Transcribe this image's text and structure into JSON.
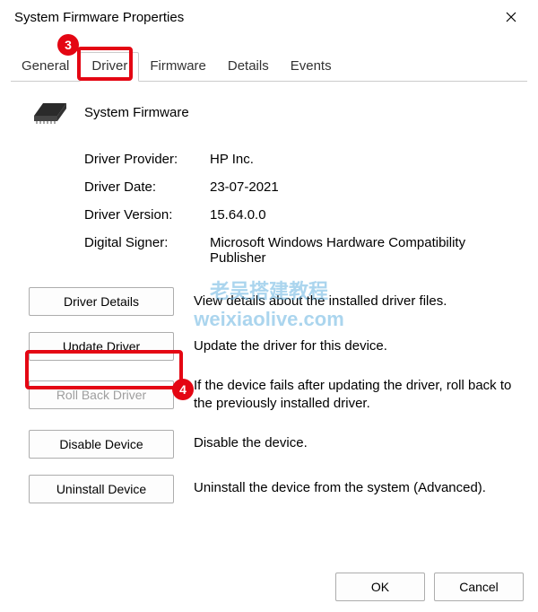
{
  "window": {
    "title": "System Firmware Properties"
  },
  "tabs": {
    "general": "General",
    "driver": "Driver",
    "firmware": "Firmware",
    "details": "Details",
    "events": "Events"
  },
  "device": {
    "name": "System Firmware"
  },
  "info": {
    "provider_label": "Driver Provider:",
    "provider_value": "HP Inc.",
    "date_label": "Driver Date:",
    "date_value": "23-07-2021",
    "version_label": "Driver Version:",
    "version_value": "15.64.0.0",
    "signer_label": "Digital Signer:",
    "signer_value": "Microsoft Windows Hardware Compatibility Publisher"
  },
  "actions": {
    "driver_details": {
      "label": "Driver Details",
      "desc": "View details about the installed driver files."
    },
    "update_driver": {
      "label": "Update Driver",
      "desc": "Update the driver for this device."
    },
    "roll_back": {
      "label": "Roll Back Driver",
      "desc": "If the device fails after updating the driver, roll back to the previously installed driver."
    },
    "disable": {
      "label": "Disable Device",
      "desc": "Disable the device."
    },
    "uninstall": {
      "label": "Uninstall Device",
      "desc": "Uninstall the device from the system (Advanced)."
    }
  },
  "footer": {
    "ok": "OK",
    "cancel": "Cancel"
  },
  "annotations": {
    "badge3": "3",
    "badge4": "4"
  },
  "watermark": {
    "line1": "老吴搭建教程",
    "line2": "weixiaolive.com"
  }
}
